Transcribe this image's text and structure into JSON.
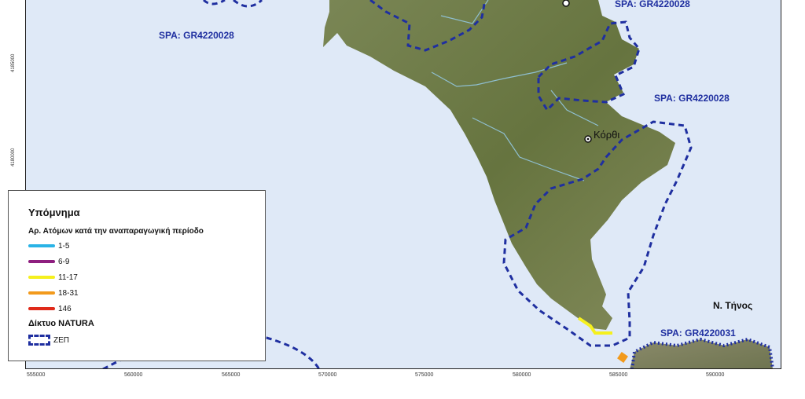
{
  "map": {
    "y_ticks": [
      "4185000",
      "4180000"
    ],
    "x_ticks": [
      "555000",
      "560000",
      "565000",
      "570000",
      "575000",
      "580000",
      "585000",
      "590000"
    ],
    "spa_labels": [
      "SPA: GR4220028",
      "SPA: GR4220028",
      "SPA: GR4220028",
      "SPA: GR4220031"
    ],
    "town_label": "Κόρθι",
    "island_label": "Ν. Τήνος",
    "colors": {
      "sea": "#dfe9f7",
      "land": "#6d7c4a",
      "spa_boundary": "#1f2fa0"
    }
  },
  "legend": {
    "title": "Υπόμνημα",
    "subtitle": "Αρ. Ατόμων κατά την αναπαραγωγική περίοδο",
    "classes": [
      {
        "label": "1-5",
        "color": "#2ab3e6"
      },
      {
        "label": "6-9",
        "color": "#8e1e7f"
      },
      {
        "label": "11-17",
        "color": "#f5f01e"
      },
      {
        "label": "18-31",
        "color": "#f29a1c"
      },
      {
        "label": "146",
        "color": "#e02a1a"
      }
    ],
    "natura_title": "Δίκτυο NATURA",
    "zep_label": "ΖΕΠ"
  }
}
